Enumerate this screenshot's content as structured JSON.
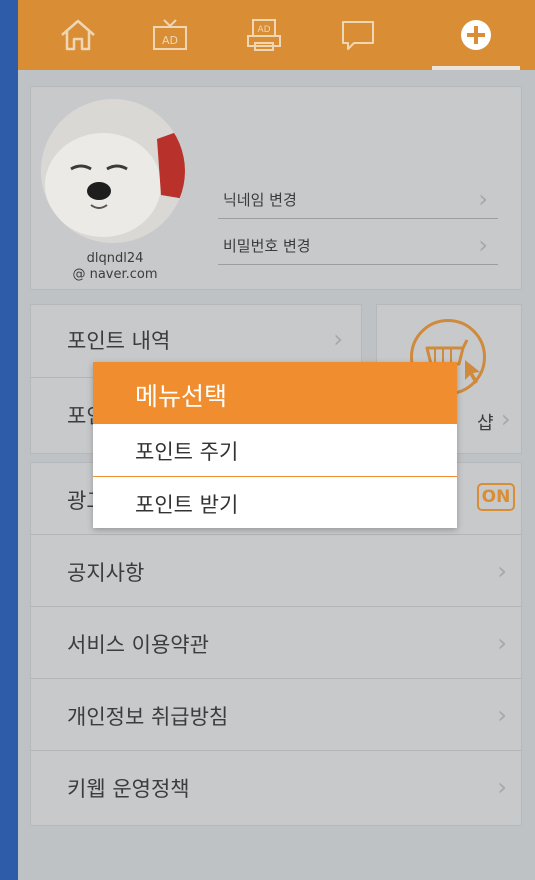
{
  "nav": {
    "items": [
      "home-icon",
      "ad-tv-icon",
      "ad-print-icon",
      "message-icon",
      "plus-icon"
    ],
    "active_index": 4,
    "accent": "#d98d34"
  },
  "profile": {
    "email_line1": "dlqndl24",
    "email_line2": "@ naver.com",
    "rows": [
      "닉네임 변경",
      "비밀번호 변경"
    ]
  },
  "points": {
    "rows": [
      "포인트 내역",
      "포인"
    ]
  },
  "shop": {
    "label": "샵"
  },
  "list": {
    "rows": [
      "광고",
      "공지사항",
      "서비스 이용약관",
      "개인정보 취급방침",
      "키웹 운영정책"
    ],
    "toggle_label": "ON"
  },
  "popup": {
    "title": "메뉴선택",
    "options": [
      "포인트 주기",
      "포인트 받기"
    ]
  },
  "chevron": "›"
}
